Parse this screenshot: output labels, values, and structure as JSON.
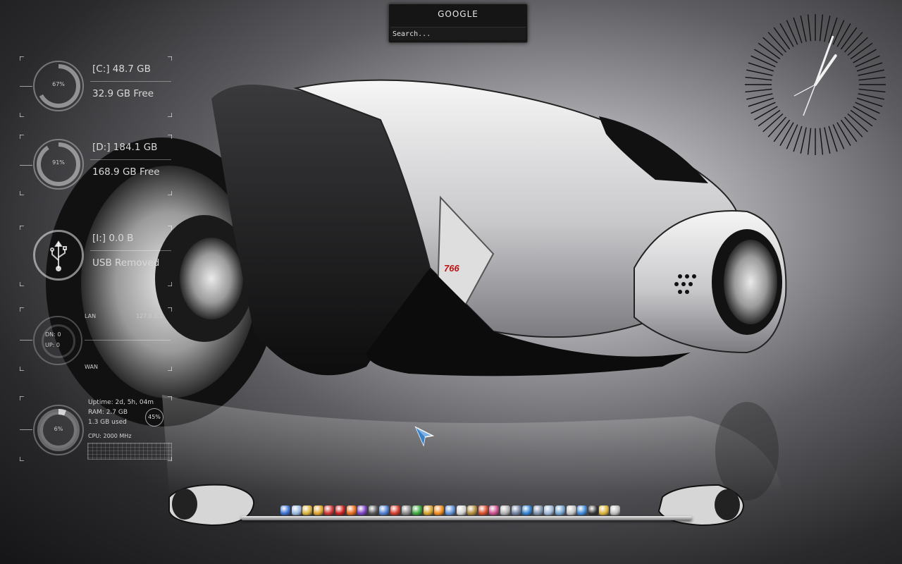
{
  "search": {
    "title": "GOOGLE",
    "placeholder": "Search..."
  },
  "drives": [
    {
      "percent": "67%",
      "usage": 0.67,
      "label": "[C:] 48.7 GB",
      "free": "32.9 GB Free"
    },
    {
      "percent": "91%",
      "usage": 0.91,
      "label": "[D:] 184.1 GB",
      "free": "168.9 GB Free"
    }
  ],
  "usb": {
    "label": "[I:] 0.0 B",
    "status": "USB Removed",
    "icon": "usb-icon"
  },
  "network": {
    "lan_label": "LAN",
    "ip": "127.0.0.1",
    "wan_label": "WAN",
    "down": "DN: 0",
    "up": "UP: 0"
  },
  "system": {
    "uptime": "Uptime:  2d, 5h, 04m",
    "ram": "RAM: 2.7 GB",
    "ram_used": "1.3 GB used",
    "ram_percent": "45%",
    "cpu": "CPU: 2000 MHz",
    "cpu_percent": "6%",
    "cpu_usage": 0.06
  },
  "clock": {
    "hour_angle": 35,
    "minute_angle": 20
  },
  "bike": {
    "number": "766"
  },
  "dock": {
    "items": [
      {
        "name": "finder-icon",
        "color": "#3b6fd1"
      },
      {
        "name": "droplet-icon",
        "color": "#9ab7e0"
      },
      {
        "name": "chrome-icon",
        "color": "#d9b13a"
      },
      {
        "name": "puzzle-icon",
        "color": "#e0a32a"
      },
      {
        "name": "dots-icon",
        "color": "#c33"
      },
      {
        "name": "acrobat-icon",
        "color": "#c8201b"
      },
      {
        "name": "firefox-icon",
        "color": "#e36a1d"
      },
      {
        "name": "vortex-icon",
        "color": "#7a3fbf"
      },
      {
        "name": "disc-icon",
        "color": "#555"
      },
      {
        "name": "sphere-icon",
        "color": "#4d7fcf"
      },
      {
        "name": "record-icon",
        "color": "#d23a2a"
      },
      {
        "name": "tool-icon",
        "color": "#888"
      },
      {
        "name": "play-icon",
        "color": "#3aa83a"
      },
      {
        "name": "folder-icon",
        "color": "#d5a32b"
      },
      {
        "name": "vlc-icon",
        "color": "#f08a1d"
      },
      {
        "name": "document-icon",
        "color": "#5b8fd6"
      },
      {
        "name": "calendar-icon",
        "color": "#cfcfcf"
      },
      {
        "name": "archive-icon",
        "color": "#b08c3a"
      },
      {
        "name": "game-icon",
        "color": "#d64a2a"
      },
      {
        "name": "chart-icon",
        "color": "#c84c8a"
      },
      {
        "name": "notes-icon",
        "color": "#b0b0b0"
      },
      {
        "name": "monitor-icon",
        "color": "#6e7fa0"
      },
      {
        "name": "globe-icon",
        "color": "#2f7fd1"
      },
      {
        "name": "book-icon",
        "color": "#7b8fa8"
      },
      {
        "name": "mail-icon",
        "color": "#9db6d6"
      },
      {
        "name": "brush-icon",
        "color": "#6fa3cf"
      },
      {
        "name": "photo-icon",
        "color": "#c0c0c0"
      },
      {
        "name": "safari-icon",
        "color": "#3d87d6"
      },
      {
        "name": "terminal-icon",
        "color": "#333"
      },
      {
        "name": "usb-drive-icon",
        "color": "#d9b13a"
      },
      {
        "name": "trash-icon",
        "color": "#bdbdbd"
      }
    ]
  }
}
